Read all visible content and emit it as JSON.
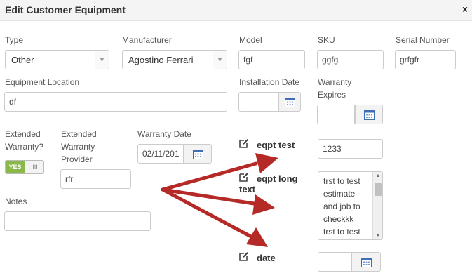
{
  "dialog": {
    "title": "Edit Customer Equipment",
    "close_label": "×"
  },
  "fields": {
    "type": {
      "label": "Type",
      "value": "Other"
    },
    "manufacturer": {
      "label": "Manufacturer",
      "value": "Agostino Ferrari"
    },
    "model": {
      "label": "Model",
      "value": "fgf"
    },
    "sku": {
      "label": "SKU",
      "value": "ggfg"
    },
    "serial_number": {
      "label": "Serial Number",
      "value": "grfgfr"
    },
    "equipment_location": {
      "label": "Equipment Location",
      "value": "df"
    },
    "installation_date": {
      "label": "Installation Date",
      "value": ""
    },
    "warranty_expires": {
      "label_line1": "Warranty",
      "label_line2": "Expires",
      "value": ""
    },
    "extended_warranty": {
      "label_line1": "Extended",
      "label_line2": "Warranty?",
      "on_label": "YES",
      "off_label": "III",
      "enabled": true
    },
    "extended_warranty_provider": {
      "label_line1": "Extended",
      "label_line2": "Warranty",
      "label_line3": "Provider",
      "value": "rfr"
    },
    "warranty_date": {
      "label": "Warranty Date",
      "value": "02/11/201"
    },
    "notes": {
      "label": "Notes",
      "value": ""
    }
  },
  "custom_fields": {
    "eqpt_test": {
      "label": "eqpt test",
      "value": "1233"
    },
    "eqpt_long_text": {
      "label_line1": "eqpt long",
      "label_line2": "text",
      "value": "trst to test\nestimate\nand job to\ncheckkk\ntrst to test"
    },
    "date": {
      "label": "date",
      "value": ""
    }
  },
  "icons": {
    "calendar": "calendar-icon",
    "edit": "edit-icon",
    "dropdown": "chevron-down-icon",
    "close": "close-icon"
  },
  "colors": {
    "header_bg": "#f4f4f4",
    "toggle_on": "#8ab84a",
    "annotation_arrow": "#b52a26",
    "input_border": "#cccccc"
  }
}
